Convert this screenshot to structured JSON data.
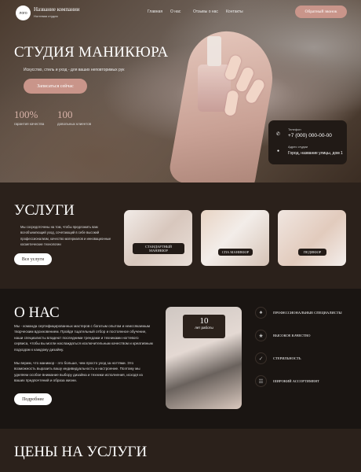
{
  "header": {
    "logo": "лого",
    "company": "Название компании",
    "tagline": "Ногтевая студия",
    "nav": [
      "Главная",
      "О нас",
      "Отзывы о нас",
      "Контакты"
    ],
    "cta": "Обратный звонок"
  },
  "hero": {
    "title": "СТУДИЯ МАНИКЮРА",
    "subtitle": "Искусство, стиль и уход - для ваших неповторимых рук",
    "button": "Записаться сейчас",
    "stats": [
      {
        "value": "100%",
        "label": "гарантия качества"
      },
      {
        "value": "100",
        "label": "довольных клиентов"
      }
    ]
  },
  "contact": {
    "phone_label": "Телефон",
    "phone": "+7 (000) 000-00-00",
    "address_label": "Адрес студии",
    "address": "Город, название улицы, дом 1"
  },
  "services": {
    "title": "УСЛУГИ",
    "text": "Мы сосредоточены на том, чтобы предложить вам всеобъемлющий уход, сочетающий в себе высокий профессионализм, качество материалов и инновационные косметические технологии",
    "button": "Все услуги",
    "cards": [
      "Стандартный маникюр",
      "Спа маникюр",
      "Педикюр"
    ]
  },
  "about": {
    "title": "О НАС",
    "p1": "Мы - команда сертифицированных мастеров с богатым опытом и неиссякаемым творческим вдохновением. Пройдя тщательный отбор и постоянное обучение, наши специалисты владеют последними трендами и техниками ногтевого сервиса, чтобы вы могли наслаждаться исключительным качеством и креативным подходом к каждому дизайну.",
    "p2": "Мы верим, что маникюр - это больше, чем просто уход за ногтями. Это возможность выразить вашу индивидуальность и настроение. Поэтому мы уделяем особое внимание выбору дизайна и техники исполнения, исходя из ваших предпочтений и образа жизни.",
    "button": "Подробнее",
    "years_value": "10",
    "years_label": "лет работы",
    "features": [
      "Профессиональные специалисты",
      "Высокое качество",
      "Стерильность",
      "Широкий ассортимент"
    ]
  },
  "prices": {
    "title": "ЦЕНЫ НА УСЛУГИ"
  },
  "colors": {
    "accent": "#c9958a",
    "dark": "#2b211b",
    "darker": "#1a1512"
  }
}
